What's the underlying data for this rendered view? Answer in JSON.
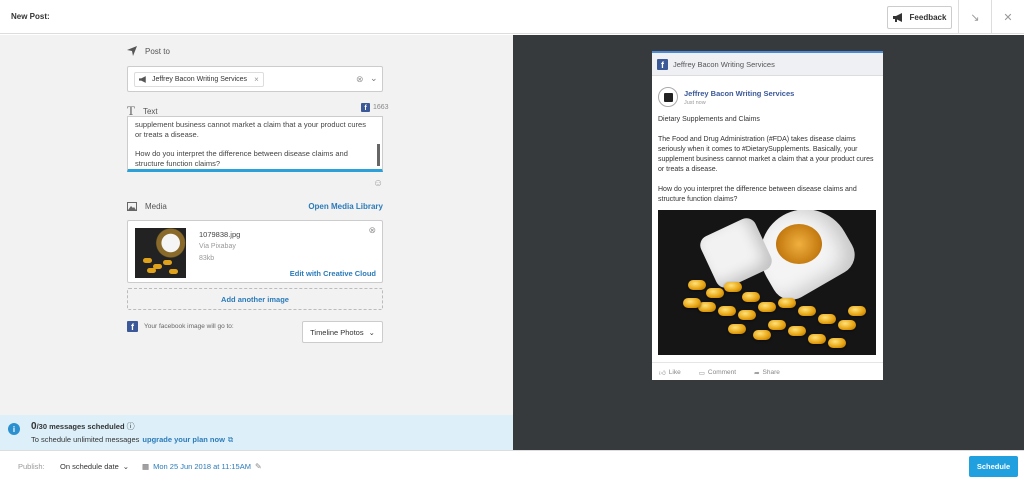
{
  "header": {
    "title": "New Post:",
    "feedback_label": "Feedback"
  },
  "compose": {
    "post_to_label": "Post to",
    "profile_name": "Jeffrey Bacon Writing Services",
    "text_label": "Text",
    "char_count": "1663",
    "text_lines": [
      "supplement business cannot market a claim that a your product cures or treats a disease.",
      "How do you interpret the difference between disease claims and structure function claims?"
    ],
    "media_label": "Media",
    "open_media_library": "Open Media Library",
    "file_name": "1079838.jpg",
    "file_source": "Via Pixabay",
    "file_size": "83kb",
    "edit_creative_cloud": "Edit with Creative Cloud",
    "add_another_image": "Add another image",
    "fb_destination_label": "Your facebook image will go to:",
    "fb_destination_value": "Timeline Photos"
  },
  "infobar": {
    "scheduled_count": "0",
    "scheduled_rest": "/30 messages scheduled",
    "upgrade_prefix": "To schedule unlimited messages",
    "upgrade_link": "upgrade your plan now"
  },
  "preview": {
    "network_header": "Jeffrey Bacon Writing Services",
    "author": "Jeffrey Bacon Writing Services",
    "time": "Just now",
    "body": [
      "Dietary Supplements and Claims",
      "The Food and Drug Administration (#FDA) takes disease claims seriously when it comes to #DietarySupplements. Basically, your supplement business cannot market a claim that a your product cures or treats a disease.",
      "How do you interpret the difference between disease claims and structure function claims?"
    ],
    "actions": {
      "like": "Like",
      "comment": "Comment",
      "share": "Share"
    }
  },
  "footer": {
    "publish_label": "Publish:",
    "publish_mode": "On schedule date",
    "publish_date": "Mon 25 Jun 2018 at 11:15AM",
    "schedule_button": "Schedule"
  },
  "colors": {
    "accent": "#21a0e0",
    "link": "#2b7bb9",
    "facebook": "#3b5998",
    "preview_bg": "#373a3c"
  },
  "icons": [
    "megaphone-icon",
    "minimize-icon",
    "close-icon",
    "send-icon",
    "text-icon",
    "facebook-icon",
    "image-icon",
    "emoji-icon",
    "info-icon",
    "help-icon",
    "external-link-icon",
    "calendar-icon",
    "pencil-icon"
  ]
}
